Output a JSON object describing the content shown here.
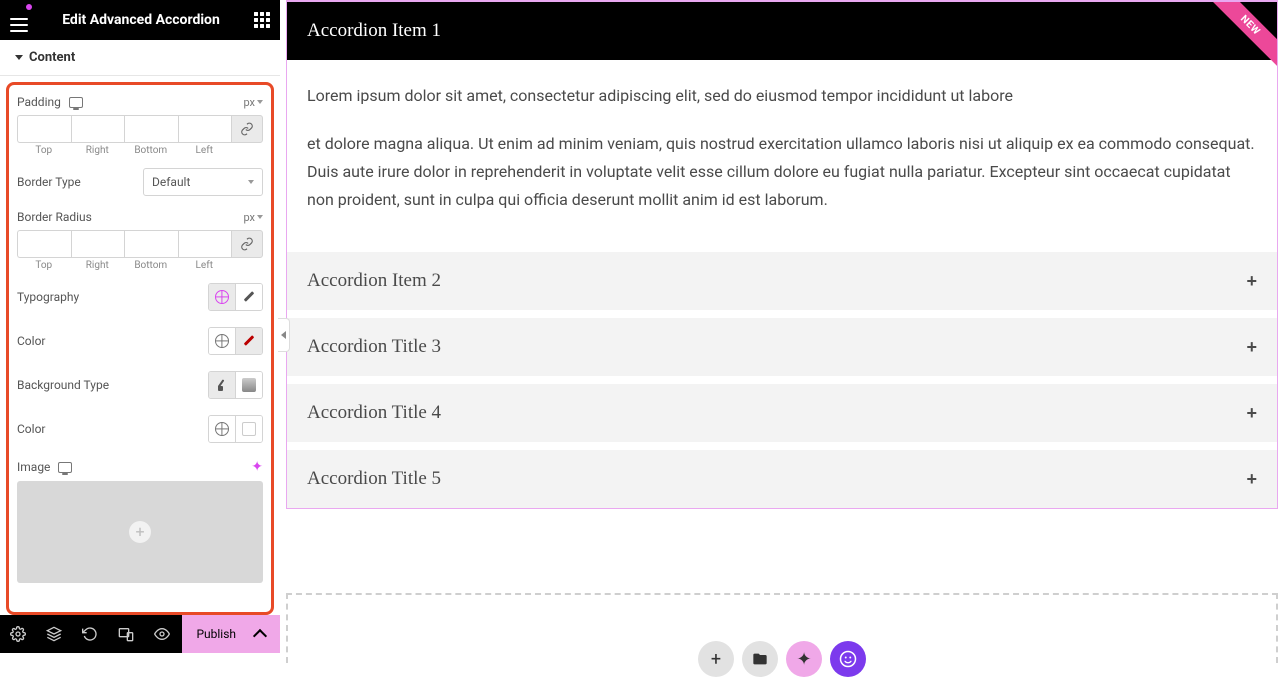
{
  "header": {
    "title": "Edit Advanced Accordion"
  },
  "section": {
    "title": "Content"
  },
  "controls": {
    "padding": {
      "label": "Padding",
      "unit": "px"
    },
    "borderType": {
      "label": "Border Type",
      "value": "Default"
    },
    "borderRadius": {
      "label": "Border Radius",
      "unit": "px"
    },
    "dimLabels": {
      "top": "Top",
      "right": "Right",
      "bottom": "Bottom",
      "left": "Left"
    },
    "typography": {
      "label": "Typography"
    },
    "color1": {
      "label": "Color"
    },
    "backgroundType": {
      "label": "Background Type"
    },
    "color2": {
      "label": "Color"
    },
    "image": {
      "label": "Image"
    }
  },
  "bottombar": {
    "publish": "Publish"
  },
  "accordion": {
    "ribbon": "NEW",
    "open": {
      "title": "Accordion Item 1"
    },
    "body": {
      "p1": "Lorem ipsum dolor sit amet, consectetur adipiscing elit, sed do eiusmod tempor incididunt ut labore",
      "p2": "et dolore magna aliqua. Ut enim ad minim veniam, quis nostrud exercitation ullamco laboris nisi ut aliquip ex ea commodo consequat. Duis aute irure dolor in reprehenderit in voluptate velit esse cillum dolore eu fugiat nulla pariatur. Excepteur sint occaecat cupidatat non proident, sunt in culpa qui officia deserunt mollit anim id est laborum."
    },
    "items": [
      {
        "title": "Accordion Item 2"
      },
      {
        "title": "Accordion Title 3"
      },
      {
        "title": "Accordion Title 4"
      },
      {
        "title": "Accordion Title 5"
      }
    ]
  }
}
